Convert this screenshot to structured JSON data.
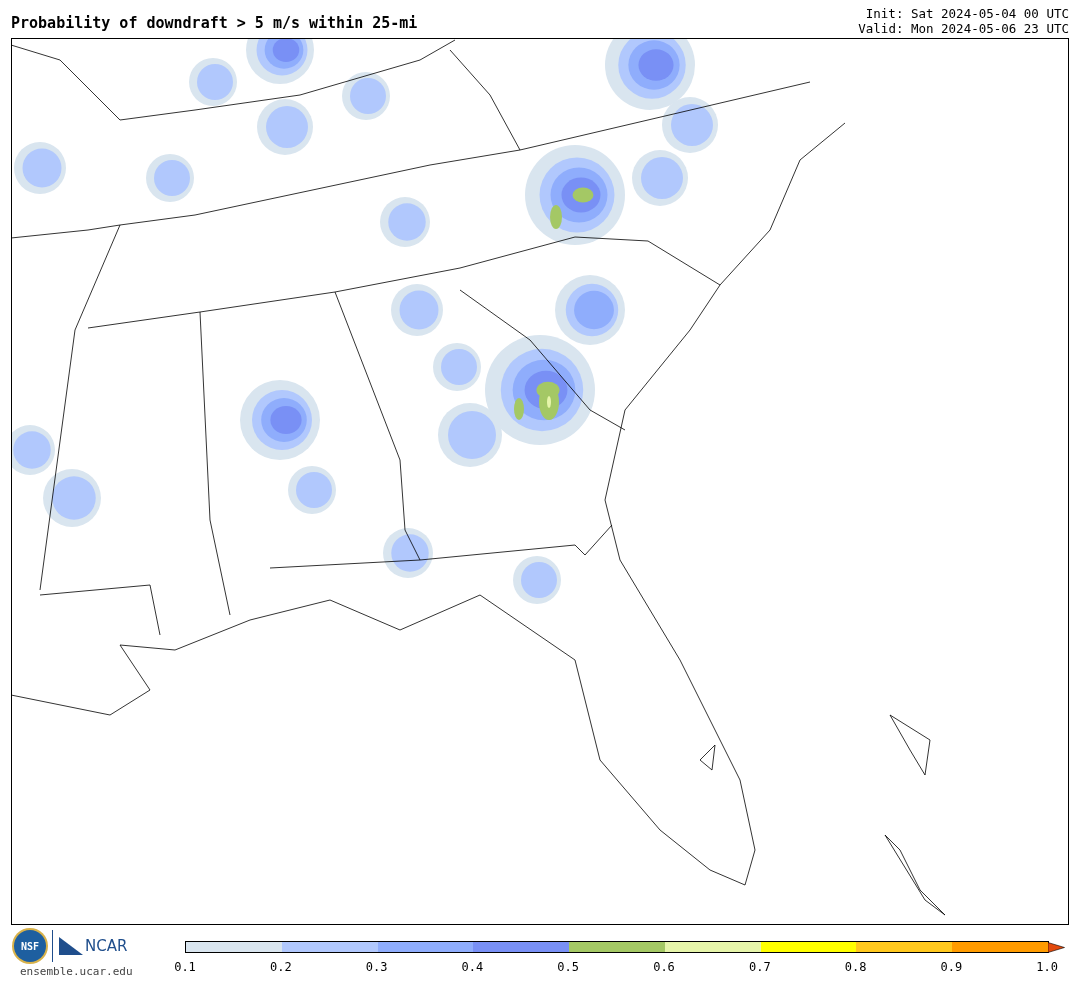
{
  "title": "Probability of downdraft > 5 m/s within 25-mi",
  "init": "Init: Sat 2024-05-04 00 UTC",
  "valid": "Valid: Mon 2024-05-06 23 UTC",
  "logo": {
    "nsf": "NSF",
    "ncar": "NCAR",
    "url": "ensemble.ucar.edu"
  },
  "colorbar": {
    "bins": [
      {
        "color": "#d9e5ef"
      },
      {
        "color": "#b1c8fd"
      },
      {
        "color": "#8fadfc"
      },
      {
        "color": "#7990f5"
      },
      {
        "color": "#a4c865"
      },
      {
        "color": "#e6f5aa"
      },
      {
        "color": "#ffff00"
      },
      {
        "color": "#ffc81e"
      },
      {
        "color": "#ff9b00"
      }
    ],
    "extend": {
      "color": "#e2490c"
    },
    "ticks": [
      "0.1",
      "0.2",
      "0.3",
      "0.4",
      "0.5",
      "0.6",
      "0.7",
      "0.8",
      "0.9",
      "1.0"
    ]
  }
}
